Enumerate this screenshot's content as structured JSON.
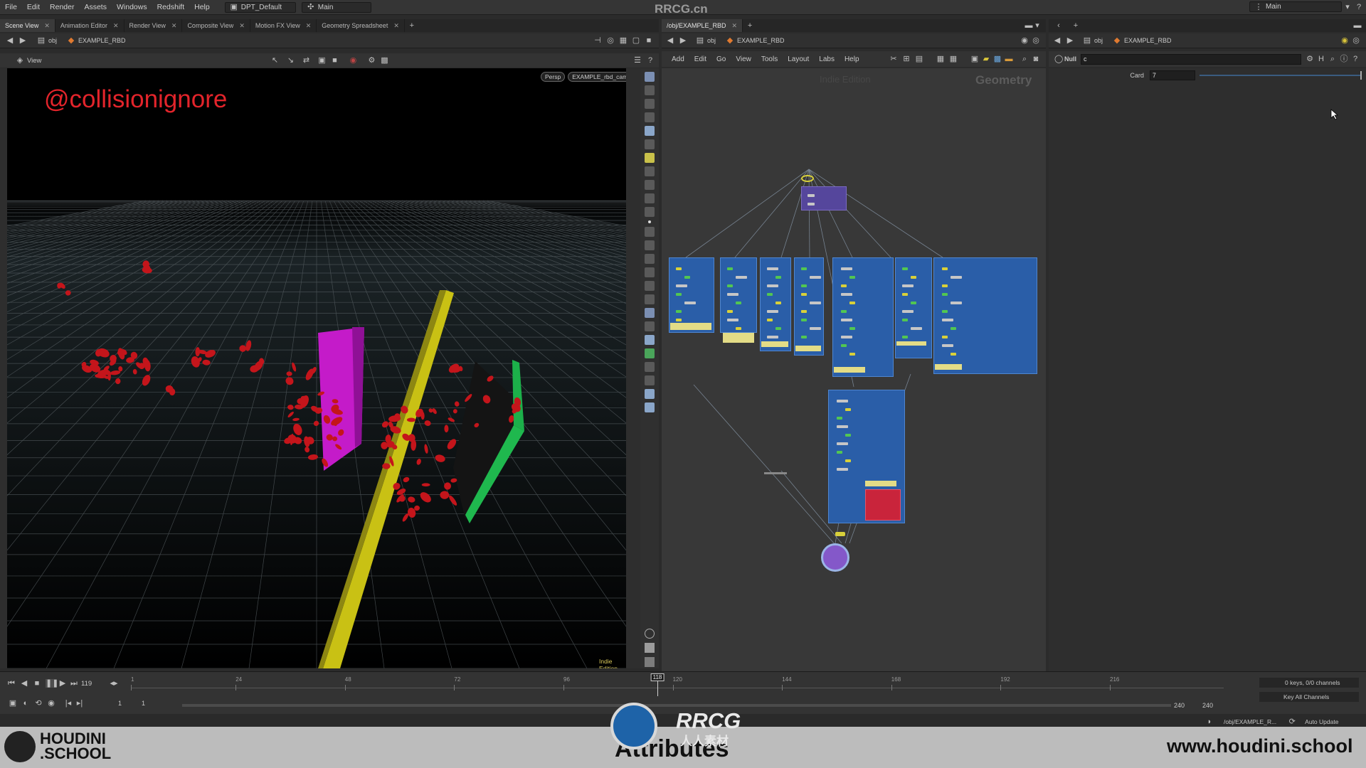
{
  "menu": {
    "items": [
      "File",
      "Edit",
      "Render",
      "Assets",
      "Windows",
      "Redshift",
      "Help"
    ],
    "desktop": "DPT_Default",
    "main": "Main",
    "right_main": "Main"
  },
  "watermark_top": "RRCG.cn",
  "left_pane": {
    "tabs": [
      "Scene View",
      "Animation Editor",
      "Render View",
      "Composite View",
      "Motion FX View",
      "Geometry Spreadsheet"
    ],
    "path": {
      "root": "obj",
      "node": "EXAMPLE_RBD"
    },
    "view_label": "View",
    "viewport_title": "@collisionignore",
    "persp": "Persp",
    "camera": "EXAMPLE_rbd_cam",
    "indie": "Indie Edition"
  },
  "mid_pane": {
    "tab": "/obj/EXAMPLE_RBD",
    "path": {
      "root": "obj",
      "node": "EXAMPLE_RBD"
    },
    "menus": [
      "Add",
      "Edit",
      "Go",
      "View",
      "Tools",
      "Layout",
      "Labs",
      "Help"
    ],
    "indie": "Indie Edition",
    "context": "Geometry"
  },
  "right_pane": {
    "path": {
      "root": "obj",
      "node": "EXAMPLE_RBD"
    },
    "node_type": "Null",
    "node_name": "c",
    "param_label": "Card",
    "param_value": "7"
  },
  "timeline": {
    "current_frame": "119",
    "ticks": [
      "1",
      "24",
      "48",
      "72",
      "96",
      "120",
      "144",
      "168",
      "192",
      "216"
    ],
    "marker": "118",
    "start": "1",
    "start2": "1",
    "end": "240",
    "end2": "240",
    "keys": "0 keys, 0/0 channels",
    "key_all": "Key All Channels"
  },
  "status": {
    "path": "/obj/EXAMPLE_R...",
    "auto_update": "Auto Update"
  },
  "footer": {
    "logo_line1": "HOUDINI",
    "logo_line2": ".SCHOOL",
    "center": "Attributes",
    "center_logo": "RRCG",
    "center_logo_sub": "人人素材",
    "website": "www.houdini.school"
  }
}
